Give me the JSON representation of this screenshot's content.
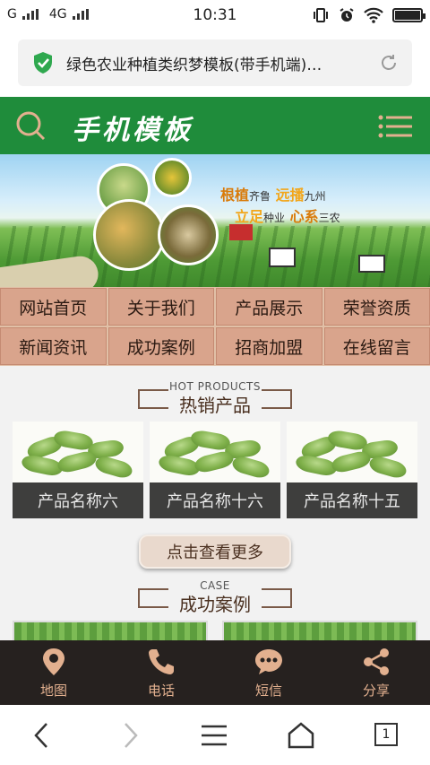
{
  "status_bar": {
    "carrier1": "G",
    "carrier2": "4G",
    "time": "10:31"
  },
  "browser": {
    "page_title": "绿色农业种植类织梦模板(带手机端)…"
  },
  "header": {
    "logo_text": "手机模板"
  },
  "banner": {
    "slogan_a1": "根植",
    "slogan_a2": "齐鲁",
    "slogan_a3": "远播",
    "slogan_a4": "九州",
    "slogan_b1": "立足",
    "slogan_b2": "种业",
    "slogan_b3": "心系",
    "slogan_b4": "三农"
  },
  "nav": {
    "items": [
      {
        "label": "网站首页"
      },
      {
        "label": "关于我们"
      },
      {
        "label": "产品展示"
      },
      {
        "label": "荣誉资质"
      },
      {
        "label": "新闻资讯"
      },
      {
        "label": "成功案例"
      },
      {
        "label": "招商加盟"
      },
      {
        "label": "在线留言"
      }
    ]
  },
  "hot_products": {
    "title_en": "HOT PRODUCTS",
    "title_cn": "热销产品",
    "items": [
      {
        "label": "产品名称六"
      },
      {
        "label": "产品名称十六"
      },
      {
        "label": "产品名称十五"
      }
    ],
    "more_label": "点击查看更多"
  },
  "cases": {
    "title_en": "CASE",
    "title_cn": "成功案例"
  },
  "bottom_bar": {
    "items": [
      {
        "label": "地图",
        "icon": "map-pin-icon"
      },
      {
        "label": "电话",
        "icon": "phone-icon"
      },
      {
        "label": "短信",
        "icon": "message-icon"
      },
      {
        "label": "分享",
        "icon": "share-icon"
      }
    ]
  },
  "system_nav": {
    "tab_count": "1"
  },
  "colors": {
    "header_green": "#1f8c3b",
    "nav_bg": "#d9a48c",
    "bottom_bar_bg": "#26211f",
    "bottom_icon": "#e2b08f"
  }
}
